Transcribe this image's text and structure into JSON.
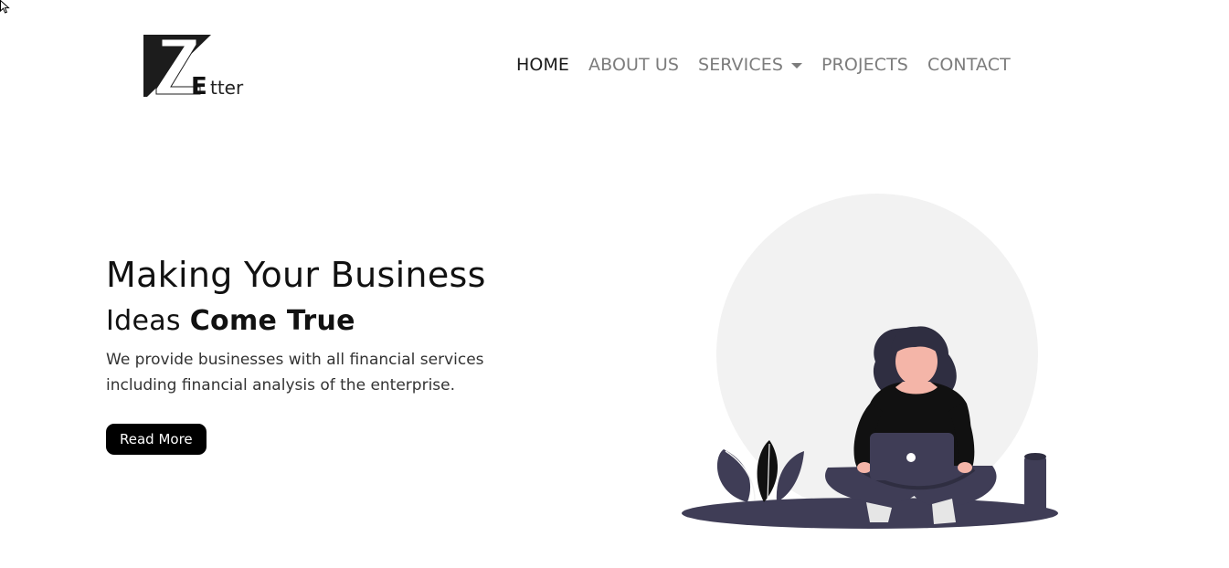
{
  "brand": {
    "logo_letter": "Z",
    "logo_suffix": "Etter"
  },
  "nav": {
    "items": [
      {
        "label": "HOME",
        "active": true
      },
      {
        "label": "ABOUT US",
        "active": false
      },
      {
        "label": "SERVICES",
        "active": false,
        "dropdown": true
      },
      {
        "label": "PROJECTS",
        "active": false
      },
      {
        "label": "CONTACT",
        "active": false
      }
    ]
  },
  "hero": {
    "title": "Making Your Business",
    "subtitle_normal": "Ideas",
    "subtitle_bold": "Come True",
    "description": "We provide businesses with all financial services including financial analysis of the enterprise.",
    "button_label": "Read More"
  },
  "colors": {
    "nav_active": "#1a1a1a",
    "nav_inactive": "#7c7c7c",
    "button_bg": "#000000",
    "illustration_circle": "#f2f2f2",
    "illustration_dark": "#3f3d56",
    "skin": "#f4b5a8"
  },
  "icons": {
    "cursor": "mouse-pointer-icon",
    "caret": "caret-down-icon",
    "logo": "zetter-logo"
  }
}
